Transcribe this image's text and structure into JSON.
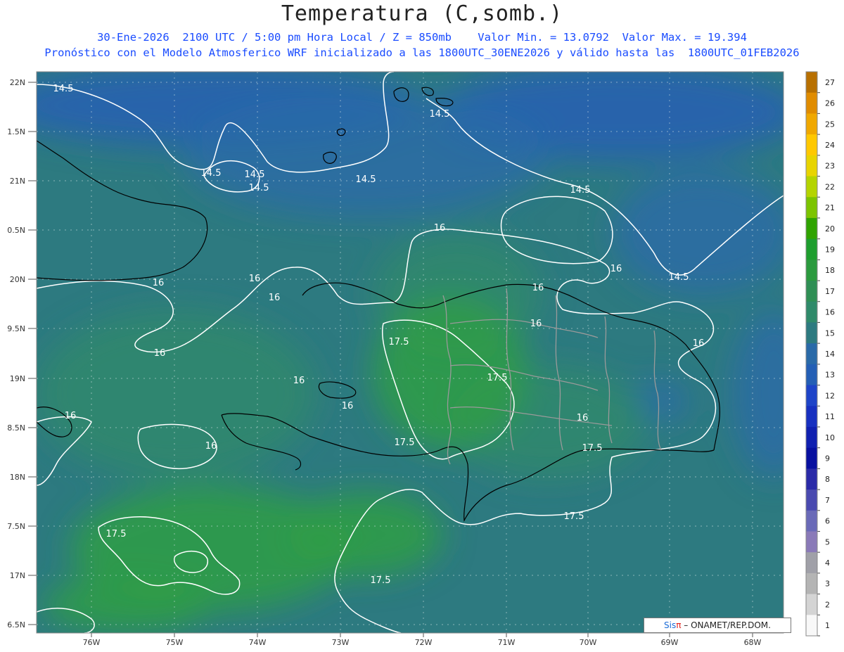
{
  "header": {
    "title": "Temperatura (C,somb.)",
    "subtitle_1": "30-Ene-2026  2100 UTC / 5:00 pm Hora Local / Z = 850mb    Valor Min. = 13.0792  Valor Max. = 19.394",
    "subtitle_2": "Pronóstico con el Modelo Atmosferico WRF inicializado a las 1800UTC_30ENE2026 y válido hasta las  1800UTC_01FEB2026"
  },
  "credit": {
    "brand": "Sis",
    "pi": "π",
    "text": "– ONAMET/REP.DOM."
  },
  "map": {
    "lat_labels": [
      "22N",
      "1.5N",
      "21N",
      "0.5N",
      "20N",
      "9.5N",
      "19N",
      "8.5N",
      "18N",
      "7.5N",
      "17N",
      "6.5N"
    ],
    "lon_labels": [
      "76W",
      "75W",
      "74W",
      "73W",
      "72W",
      "71W",
      "70W",
      "69W",
      "68W"
    ],
    "contour_labels": [
      "14.5",
      "14.5",
      "14.5",
      "14.5",
      "14.5",
      "14.5",
      "14.5",
      "14.5",
      "16",
      "16",
      "16",
      "16",
      "16",
      "16",
      "16",
      "16",
      "16",
      "16",
      "16",
      "16",
      "16",
      "16",
      "17.5",
      "17.5",
      "17.5",
      "17.5",
      "17.5",
      "17.5",
      "17.5"
    ],
    "colors": {
      "deep": "#2d7a80",
      "mid": "#2f8a6a",
      "warm": "#2f9e45",
      "cool": "#2a6aa8",
      "cold": "#245fb5",
      "contour": "#ffffff",
      "coast": "#000000",
      "border": "#9a9a9a"
    }
  },
  "colorbar": {
    "levels": [
      27,
      26,
      25,
      24,
      23,
      22,
      21,
      20,
      19,
      18,
      17,
      16,
      15,
      14,
      13,
      12,
      11,
      10,
      9,
      8,
      7,
      6,
      5,
      4,
      3,
      2,
      1
    ],
    "colors": [
      "#b87000",
      "#e08c00",
      "#f0a800",
      "#ffc800",
      "#e8d400",
      "#b4d400",
      "#7cc400",
      "#2fa300",
      "#1e9e2e",
      "#2b9a3e",
      "#2f8f55",
      "#2f8a6a",
      "#2d7a80",
      "#2a6aa8",
      "#245fb5",
      "#1e44c8",
      "#1730c0",
      "#1020b0",
      "#0810a0",
      "#2a2aa8",
      "#4a4ab0",
      "#6a6ab8",
      "#8a7ab8",
      "#a0a0a8",
      "#b4b4b4",
      "#d4d4d4",
      "#f8f8f8"
    ]
  }
}
